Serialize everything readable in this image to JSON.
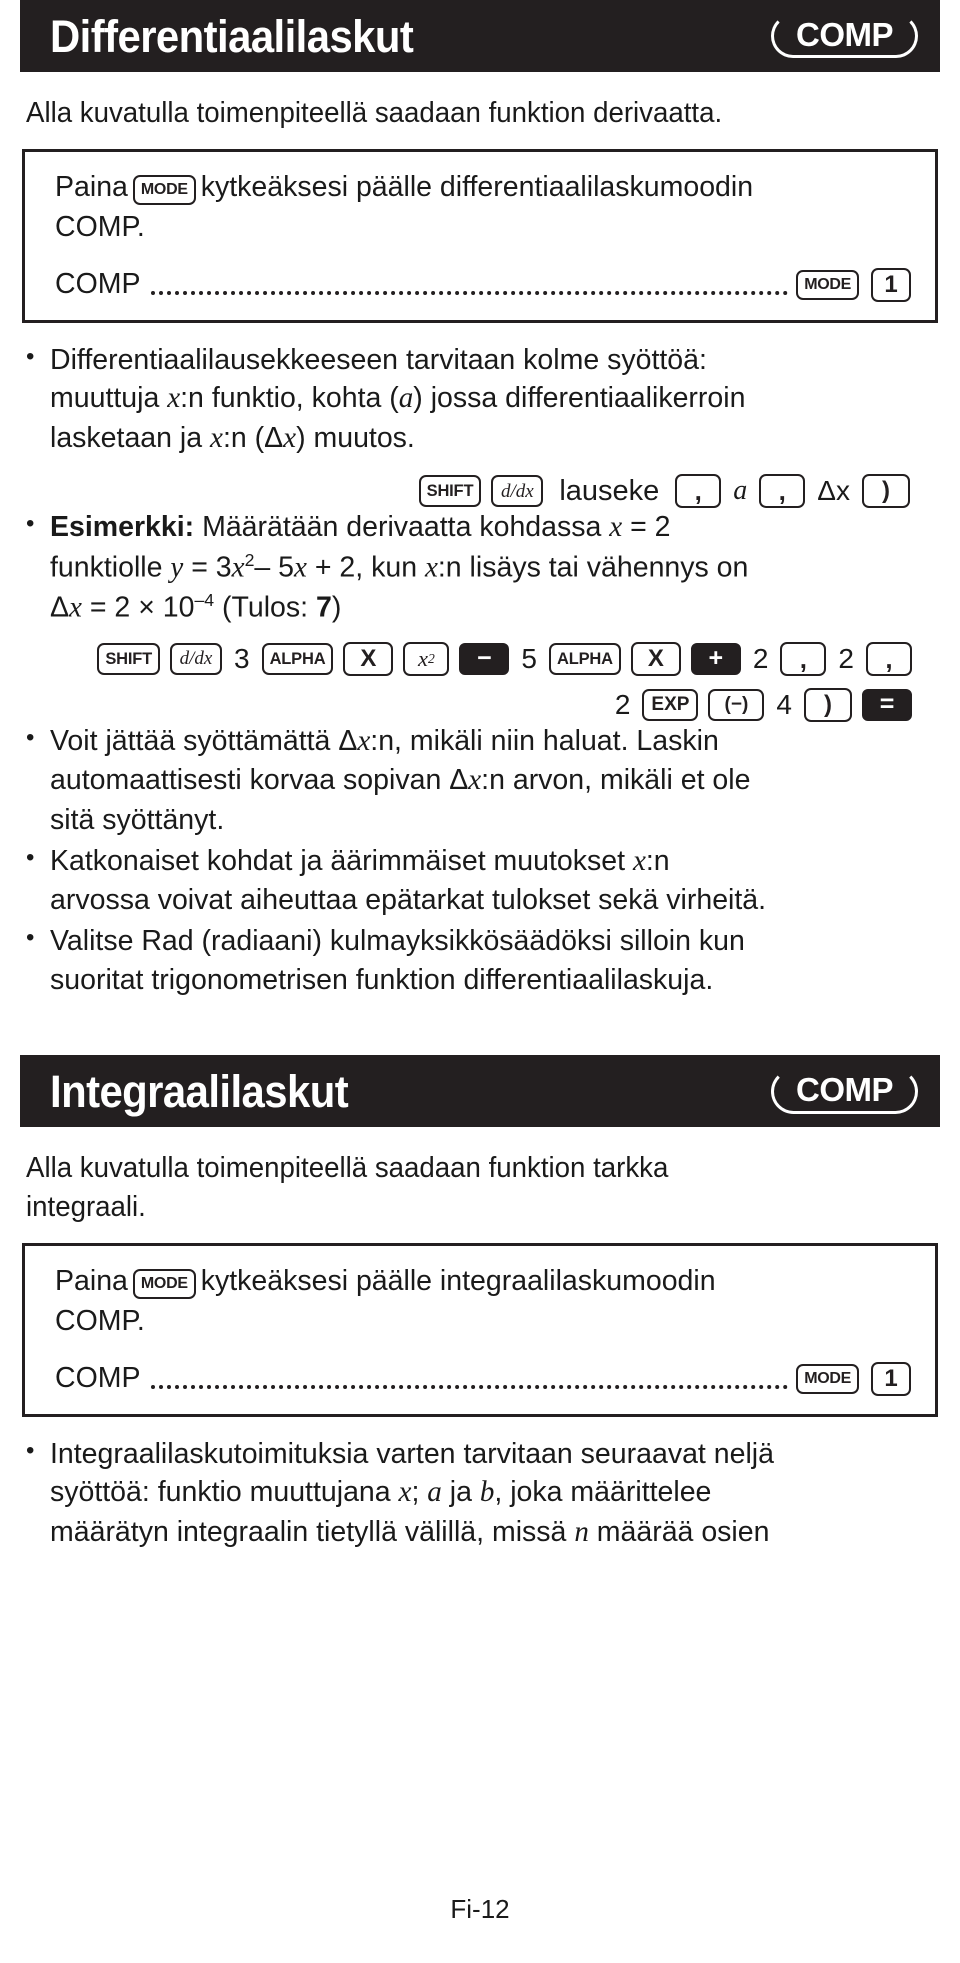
{
  "page": {
    "footer_label": "Fi-12",
    "accent_dark": "#231f20",
    "background": "#ffffff"
  },
  "sections": [
    {
      "id": "differential",
      "title": "Differentiaalilaskut",
      "mode_badge": "COMP",
      "intro": "Alla kuvatulla toimenpiteellä saadaan funktion derivaatta.",
      "note_box": {
        "line_prefix": "Paina",
        "key_mode": "MODE",
        "line_suffix": "kytkeäksesi päälle differentiaalilaskumoodin",
        "line_2": "COMP.",
        "mode_row": {
          "label": "COMP",
          "leader": "..............................................",
          "keys": [
            "MODE",
            "1"
          ]
        }
      },
      "bullets": [
        {
          "id": "three-inputs",
          "text": "Differentiaalilausekkeeseen tarvitaan kolme syöttöä: muuttuja x:n funktio, kohta (a) jossa differentiaalikerroin lasketaan ja x:n (Δx) muutos."
        },
        {
          "id": "example",
          "lead": "Esimerkki:",
          "text": "Määrätään derivaatta kohdassa x = 2 funktiolle y = 3x² – 5x + 2, kun x:n lisäys tai vähennys on Δx = 2 × 10⁻⁴ (Tulos: 7)"
        },
        {
          "id": "omit-delta",
          "text": "Voit jättää syöttämättä Δx:n, mikäli niin haluat. Laskin automaattisesti korvaa sopivan Δx:n arvon, mikäli et ole sitä syöttänyt."
        },
        {
          "id": "discontinuous",
          "text": "Katkonaiset kohdat ja äärimmäiset muutokset x:n arvossa voivat aiheuttaa epätarkat tulokset sekä virheitä."
        },
        {
          "id": "rad-mode",
          "text": "Valitse Rad (radiaani) kulmayksikkösäädöksi silloin kun suoritat trigonometrisen funktion differentiaalilaskuja."
        }
      ],
      "syntax_sequence": {
        "id": "derivative-syntax",
        "keys": [
          "SHIFT",
          "d/dx"
        ],
        "word": "lauseke",
        "tokens": [
          ",",
          "a",
          ",",
          "Δx",
          ")"
        ]
      },
      "example_sequence_row1": [
        "SHIFT",
        "d/dx",
        "3",
        "ALPHA",
        "X",
        "x²",
        "−",
        "5",
        "ALPHA",
        "X",
        "+",
        "2",
        ",",
        "2",
        ","
      ],
      "example_sequence_row2": [
        "2",
        "EXP",
        "(−)",
        "4",
        ")",
        "="
      ]
    },
    {
      "id": "integral",
      "title": "Integraalilaskut",
      "mode_badge": "COMP",
      "intro": "Alla kuvatulla toimenpiteellä saadaan funktion tarkka integraali.",
      "note_box": {
        "line_prefix": "Paina",
        "key_mode": "MODE",
        "line_suffix": "kytkeäksesi päälle integraalilaskumoodin",
        "line_2": "COMP.",
        "mode_row": {
          "label": "COMP",
          "leader": "..............................................",
          "keys": [
            "MODE",
            "1"
          ]
        }
      },
      "bullets": [
        {
          "id": "four-inputs",
          "text": "Integraalilaskutoimituksia varten tarvitaan seuraavat neljä syöttöä: funktio muuttujana x; a ja b, joka määrittelee määrätyn integraalin tietyllä välillä, missä n määrää osien"
        }
      ]
    }
  ],
  "text_fragments": {
    "b1_a": "Differentiaalilausekkeeseen tarvitaan kolme syöttöä:",
    "b1_b_pre": "muuttuja ",
    "b1_x": "x",
    "b1_b_mid": ":n funktio, kohta (",
    "b1_a_var": "a",
    "b1_b_post": ") jossa differentiaalikerroin",
    "b1_c_pre": "lasketaan ja ",
    "b1_c_mid": ":n (Δ",
    "b1_c_post": ") muutos.",
    "b2_lead": "Esimerkki:",
    "b2_a": "Määrätään derivaatta kohdassa ",
    "b2_a_eq": " = 2",
    "b2_b_pre": "funktiolle ",
    "b2_y": "y",
    "b2_b_eq": " = 3",
    "b2_b_x": "x",
    "b2_b_sup": "2",
    "b2_b_mid": "– 5",
    "b2_b_post": " + 2, kun ",
    "b2_b_end": ":n lisäys tai vähennys on",
    "b2_c_pre": "Δ",
    "b2_c": " = 2 × 10",
    "b2_c_sup": "–4",
    "b2_c_post": " (Tulos: ",
    "b2_c_res": "7",
    "b2_c_close": ")",
    "b3_a": "Voit jättää syöttämättä Δ",
    "b3_a2": ":n, mikäli niin haluat. Laskin",
    "b3_b": "automaattisesti korvaa sopivan Δ",
    "b3_b2": ":n arvon, mikäli et ole",
    "b3_c": "sitä syöttänyt.",
    "b4_a": "Katkonaiset kohdat ja äärimmäiset muutokset ",
    "b4_a2": ":n",
    "b4_b": "arvossa voivat aiheuttaa epätarkat tulokset sekä virheitä.",
    "b5_a": "Valitse Rad (radiaani) kulmayksikkösäädöksi silloin kun",
    "b5_b": "suoritat trigonometrisen funktion differentiaalilaskuja.",
    "i1_a": "Integraalilaskutoimituksia varten tarvitaan seuraavat neljä",
    "i1_b_pre": "syöttöä: funktio muuttujana ",
    "i1_b_x": "x",
    "i1_b_mid": "; ",
    "i1_b_a": "a",
    "i1_b_ja": " ja ",
    "i1_b_b": "b",
    "i1_b_post": ", joka määrittelee",
    "i1_c_pre": "määrätyn integraalin tietyllä välillä, missä ",
    "i1_c_n": "n",
    "i1_c_post": " määrää osien",
    "intro2_a": "Alla kuvatulla toimenpiteellä saadaan funktion tarkka",
    "intro2_b": "integraali."
  }
}
